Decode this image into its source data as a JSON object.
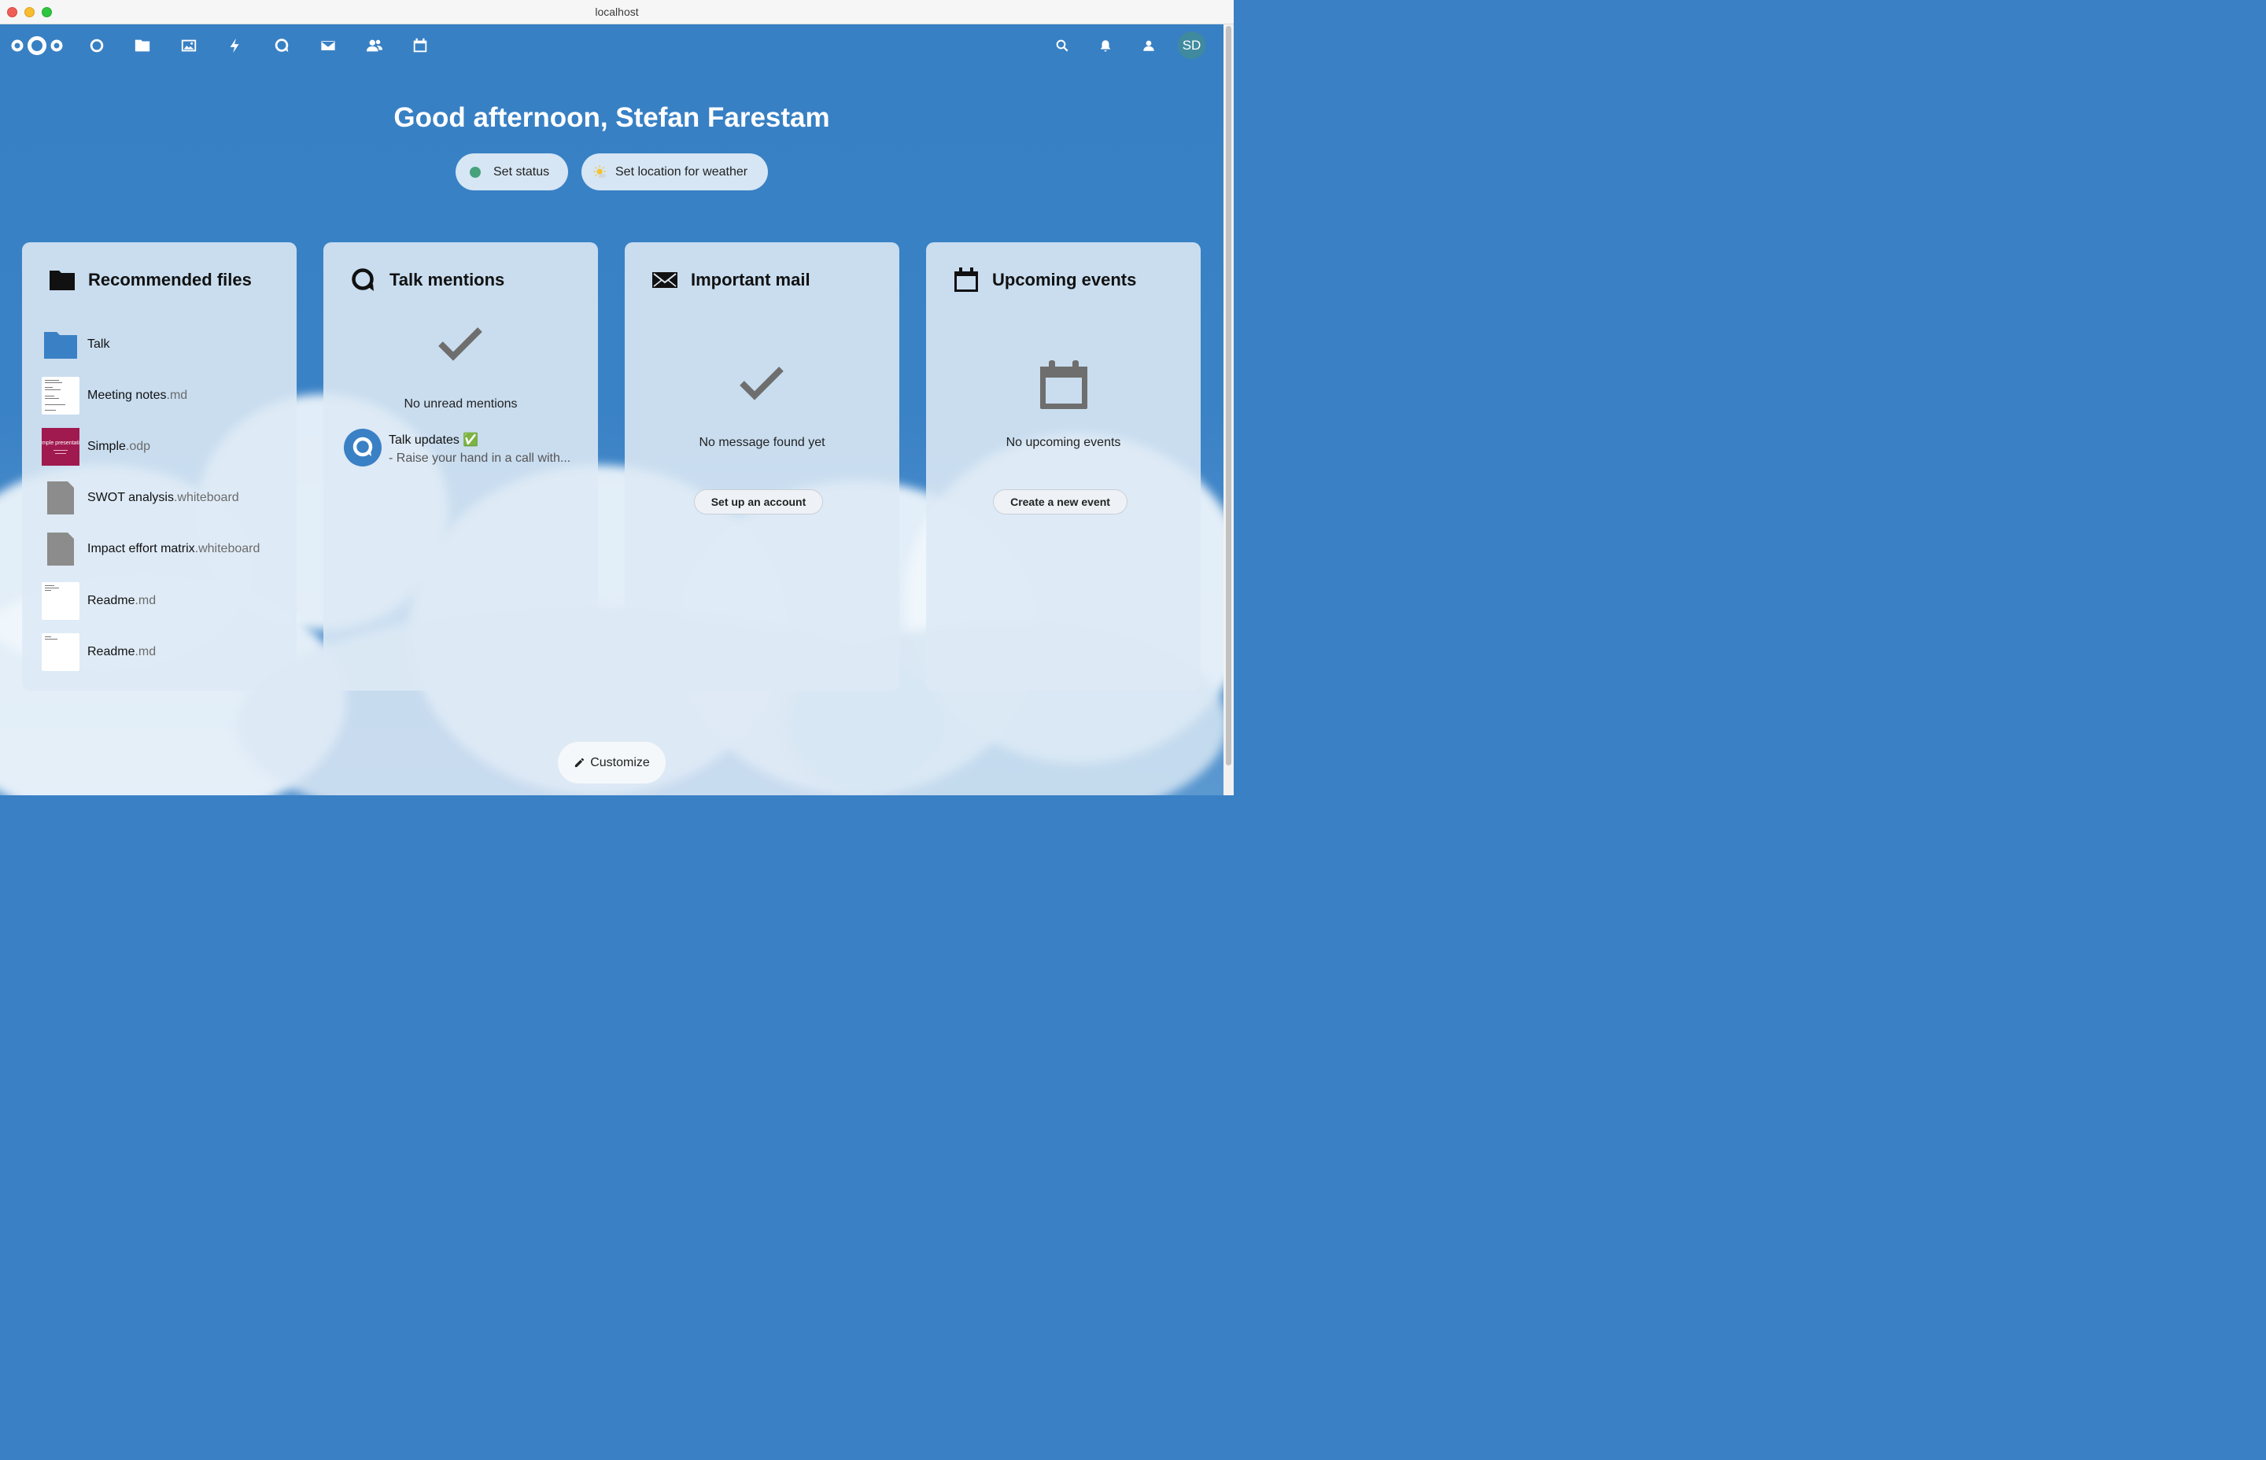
{
  "window": {
    "title": "localhost"
  },
  "header": {
    "nav_icons": [
      "dashboard-icon",
      "files-icon",
      "photos-icon",
      "activity-icon",
      "talk-icon",
      "mail-icon",
      "contacts-icon",
      "calendar-icon"
    ],
    "right_icons": [
      "search-icon",
      "notifications-icon",
      "contacts-menu-icon"
    ],
    "avatar_initials": "SD",
    "avatar_color": "#3f8a9e"
  },
  "greeting": {
    "text": "Good afternoon, Stefan Farestam",
    "set_status": "Set status",
    "set_weather": "Set location for weather"
  },
  "panels": {
    "files": {
      "title": "Recommended files",
      "items": [
        {
          "name": "Talk",
          "ext": ""
        },
        {
          "name": "Meeting notes",
          "ext": ".md"
        },
        {
          "name": "Simple",
          "ext": ".odp",
          "thumb_text": "mple presentati"
        },
        {
          "name": "SWOT analysis",
          "ext": ".whiteboard"
        },
        {
          "name": "Impact effort matrix",
          "ext": ".whiteboard"
        },
        {
          "name": "Readme",
          "ext": ".md"
        },
        {
          "name": "Readme",
          "ext": ".md"
        }
      ]
    },
    "talk": {
      "title": "Talk mentions",
      "empty": "No unread mentions",
      "item_title": "Talk updates ✅",
      "item_subtitle": "- Raise your hand in a call with..."
    },
    "mail": {
      "title": "Important mail",
      "empty": "No message found yet",
      "button": "Set up an account"
    },
    "events": {
      "title": "Upcoming events",
      "empty": "No upcoming events",
      "button": "Create a new event"
    }
  },
  "customize": "Customize",
  "colors": {
    "brand": "#3a80c5",
    "status_online": "#46a27b",
    "simple_thumb": "#a0194f"
  }
}
